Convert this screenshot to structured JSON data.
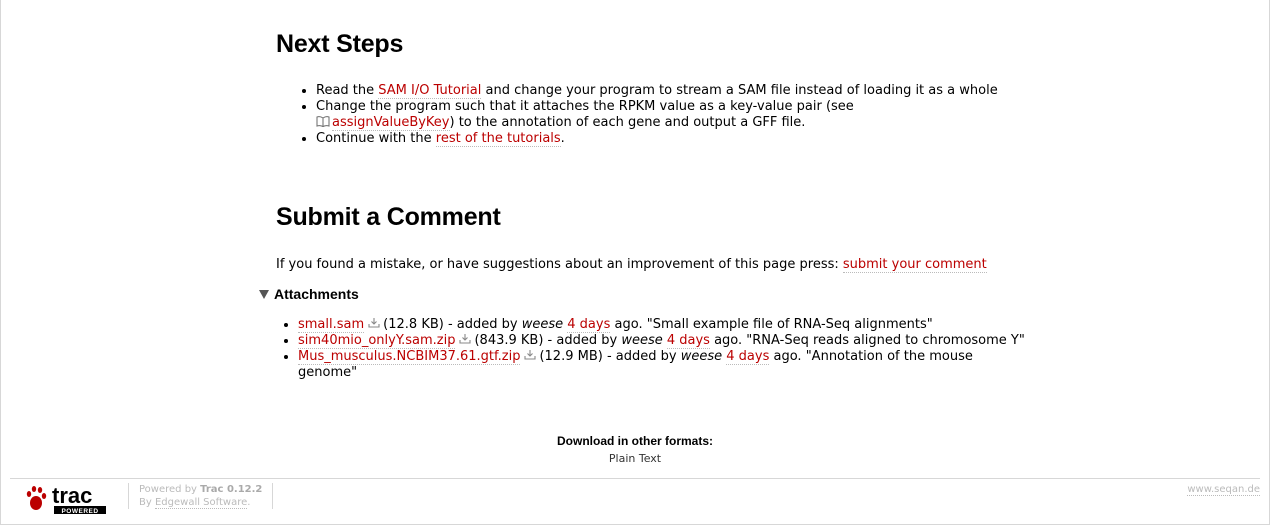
{
  "next_steps": {
    "title": "Next Steps",
    "item1_pre": "Read the ",
    "item1_link": "SAM I/O Tutorial",
    "item1_post": " and change your program to stream a SAM file instead of loading it as a whole",
    "item2_pre": "Change the program such that it attaches the RPKM value as a key-value pair (see ",
    "item2_link": "assignValueByKey",
    "item2_post": ") to the annotation of each gene and output a GFF file.",
    "item3_pre": "Continue with the ",
    "item3_link": "rest of the tutorials",
    "item3_post": "."
  },
  "submit": {
    "title": "Submit a Comment",
    "text": "If you found a mistake, or have suggestions about an improvement of this page press: ",
    "link": "submit your comment"
  },
  "attachments": {
    "heading": "Attachments",
    "items": [
      {
        "file": "small.sam",
        "size": "(12.8 KB)",
        "added": " - added by ",
        "author": "weese",
        "age": "4 days",
        "ago": " ago. ",
        "desc": "\"Small example file of RNA-Seq alignments\""
      },
      {
        "file": "sim40mio_onlyY.sam.zip",
        "size": "(843.9 KB)",
        "added": " - added by ",
        "author": "weese",
        "age": "4 days",
        "ago": " ago. ",
        "desc": "\"RNA-Seq reads aligned to chromosome Y\""
      },
      {
        "file": "Mus_musculus.NCBIM37.61.gtf.zip",
        "size": "(12.9 MB)",
        "added": " - added by ",
        "author": "weese",
        "age": "4 days",
        "ago": " ago. ",
        "desc": "\"Annotation of the mouse genome\""
      }
    ]
  },
  "download": {
    "label": "Download in other formats:",
    "format": "Plain Text"
  },
  "footer": {
    "logo_text": "trac",
    "logo_sub": "POWERED",
    "powered_pre": "Powered by ",
    "powered_name": "Trac 0.12.2",
    "by_pre": "By ",
    "by_name": "Edgewall Software",
    "by_post": ".",
    "site": "www.seqan.de"
  },
  "colors": {
    "link": "#bb0000",
    "muted": "#bbbbbb"
  },
  "icons": [
    "book-icon",
    "download-icon",
    "paw-icon",
    "collapse-triangle-icon"
  ]
}
